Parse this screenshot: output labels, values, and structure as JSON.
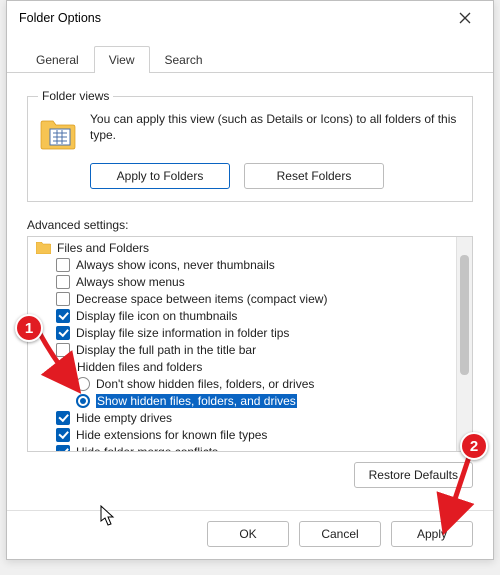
{
  "window": {
    "title": "Folder Options"
  },
  "tabs": {
    "general": "General",
    "view": "View",
    "search": "Search"
  },
  "folderViews": {
    "legend": "Folder views",
    "description": "You can apply this view (such as Details or Icons) to all folders of this type.",
    "applyBtn": "Apply to Folders",
    "resetBtn": "Reset Folders"
  },
  "advanced": {
    "label": "Advanced settings:",
    "rootLabel": "Files and Folders",
    "items": {
      "thumbnailsIcons": "Always show icons, never thumbnails",
      "alwaysMenus": "Always show menus",
      "compactView": "Decrease space between items (compact view)",
      "fileIconThumb": "Display file icon on thumbnails",
      "folderTips": "Display file size information in folder tips",
      "fullPathTitle": "Display the full path in the title bar",
      "hiddenGroup": "Hidden files and folders",
      "hiddenDont": "Don't show hidden files, folders, or drives",
      "hiddenShow": "Show hidden files, folders, and drives",
      "hideEmpty": "Hide empty drives",
      "hideExt": "Hide extensions for known file types",
      "hideMerge": "Hide folder merge conflicts"
    }
  },
  "buttons": {
    "restore": "Restore Defaults",
    "ok": "OK",
    "cancel": "Cancel",
    "apply": "Apply"
  },
  "annotations": {
    "badge1": "1",
    "badge2": "2"
  }
}
